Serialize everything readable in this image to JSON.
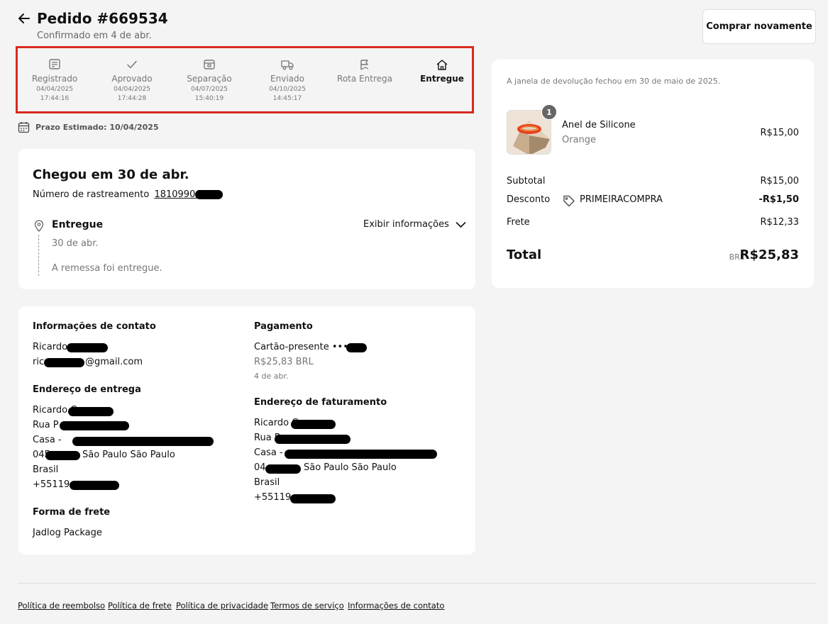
{
  "header": {
    "title": "Pedido #669534",
    "subtitle": "Confirmado em 4 de abr.",
    "buy_again": "Comprar novamente"
  },
  "tracker": {
    "steps": [
      {
        "label": "Registrado",
        "date": "04/04/2025",
        "time": "17:44:16",
        "icon": "note-icon"
      },
      {
        "label": "Aprovado",
        "date": "04/04/2025",
        "time": "17:44:28",
        "icon": "check-icon"
      },
      {
        "label": "Separação",
        "date": "04/07/2025",
        "time": "15:40:19",
        "icon": "box-icon"
      },
      {
        "label": "Enviado",
        "date": "04/10/2025",
        "time": "14:45:17",
        "icon": "truck-icon"
      },
      {
        "label": "Rota Entrega",
        "date": "",
        "time": "",
        "icon": "route-icon"
      },
      {
        "label": "Entregue",
        "date": "",
        "time": "",
        "icon": "home-icon"
      }
    ],
    "eta": "Prazo Estimado: 10/04/2025"
  },
  "tracking": {
    "heading": "Chegou em 30 de abr.",
    "number_label": "Número de rastreamento",
    "number": "1810990689",
    "status": "Entregue",
    "status_date": "30 de abr.",
    "status_msg": "A remessa foi entregue.",
    "toggle": "Exibir informações"
  },
  "contact": {
    "heading": "Informações de contato",
    "name": "Ricardo",
    "email_prefix": "ric",
    "email_suffix": "@gmail.com"
  },
  "shipping_address": {
    "heading": "Endereço de entrega",
    "line1": "Ricardo C",
    "line2": "Rua P",
    "line3": "Casa - ",
    "line4_prefix": "045",
    "line4_suffix": "São Paulo São Paulo",
    "country": "Brasil",
    "phone": "+55119"
  },
  "shipping_method": {
    "heading": "Forma de frete",
    "value": "Jadlog Package"
  },
  "payment": {
    "heading": "Pagamento",
    "method": "Cartão-presente ••••",
    "amount": "R$25,83 BRL",
    "date": "4 de abr."
  },
  "billing_address": {
    "heading": "Endereço de faturamento",
    "line1": "Ricardo C",
    "line2": "Rua R",
    "line3": "Casa - ",
    "line4_prefix": "04",
    "line4_suffix": "São Paulo São Paulo",
    "country": "Brasil",
    "phone": "+55119"
  },
  "summary": {
    "return_note": "A janela de devolução fechou em 30 de maio de 2025.",
    "item_qty": "1",
    "item_name": "Anel de Silicone",
    "item_variant": "Orange",
    "item_price": "R$15,00",
    "subtotal_label": "Subtotal",
    "subtotal": "R$15,00",
    "discount_label": "Desconto",
    "discount_code": "PRIMEIRACOMPRA",
    "discount": "-R$1,50",
    "shipping_label": "Frete",
    "shipping": "R$12,33",
    "total_label": "Total",
    "currency": "BRL",
    "total": "R$25,83"
  },
  "footer": {
    "links": [
      "Política de reembolso",
      "Política de frete",
      "Política de privacidade",
      "Termos de serviço",
      "Informações de contato"
    ]
  },
  "colors": {
    "highlight_border": "#d82a1f",
    "background": "#f4f4f4",
    "card": "#ffffff",
    "redaction": "#000000"
  }
}
